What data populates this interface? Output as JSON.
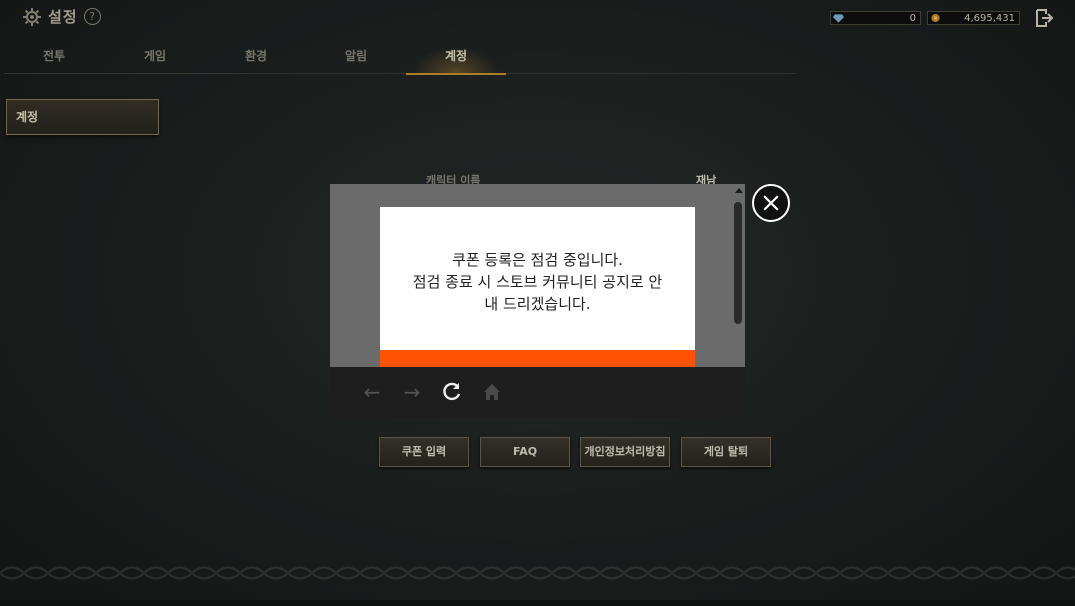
{
  "header": {
    "title": "설정",
    "help_icon": "?",
    "currency": [
      {
        "icon": "diamond-icon",
        "value": "0"
      },
      {
        "icon": "gold-coin-icon",
        "value": "4,695,431"
      }
    ],
    "exit_icon": "exit-icon"
  },
  "tabs": [
    {
      "label": "전투"
    },
    {
      "label": "게임"
    },
    {
      "label": "환경"
    },
    {
      "label": "알림"
    },
    {
      "label": "계정",
      "active": true
    }
  ],
  "sidebar": {
    "items": [
      {
        "label": "계정",
        "selected": true
      }
    ]
  },
  "account": {
    "character_name_label": "캐릭터 이름",
    "character_name_value": "재남"
  },
  "buttons": {
    "coupon": "쿠폰 입력",
    "faq": "FAQ",
    "privacy": "개인정보처리방침",
    "withdraw": "게임 탈퇴"
  },
  "popup": {
    "message_line1": "쿠폰 등록은 점검 중입니다.",
    "message_line2": "점검 종료 시 스토브 커뮤니티 공지로 안",
    "message_line3": "내 드리겠습니다.",
    "accent_color": "#ff5200",
    "nav": {
      "back": "←",
      "forward": "→",
      "refresh": "refresh-icon",
      "home": "home-icon"
    }
  },
  "colors": {
    "active_tab": "#c9962f",
    "background": "#1f2322"
  }
}
